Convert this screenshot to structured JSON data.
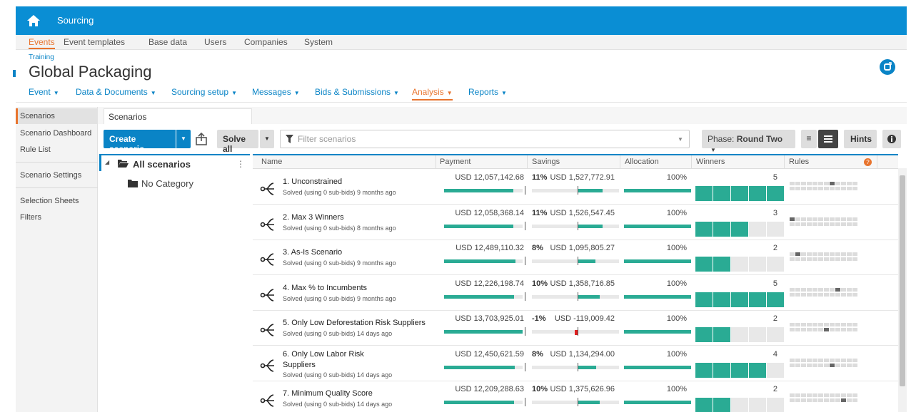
{
  "app": {
    "title": "Sourcing"
  },
  "topnav": [
    "Events",
    "Event templates",
    "Base data",
    "Users",
    "Companies",
    "System"
  ],
  "breadcrumb": "Training",
  "page_title": "Global Packaging",
  "menu": [
    {
      "label": "Event"
    },
    {
      "label": "Data & Documents"
    },
    {
      "label": "Sourcing setup"
    },
    {
      "label": "Messages"
    },
    {
      "label": "Bids & Submissions"
    },
    {
      "label": "Analysis"
    },
    {
      "label": "Reports"
    }
  ],
  "sidebar": [
    "Scenarios",
    "Scenario Dashboard",
    "Rule List",
    "Scenario Settings",
    "Selection Sheets",
    "Filters"
  ],
  "tab_label": "Scenarios",
  "toolbar": {
    "create": "Create scenario",
    "solve_all": "Solve all",
    "filter_placeholder": "Filter scenarios",
    "phase_prefix": "Phase:",
    "phase_value": "Round Two",
    "hints": "Hints"
  },
  "tree": {
    "root": "All scenarios",
    "child": "No Category"
  },
  "columns": [
    "Name",
    "Payment",
    "Savings",
    "Allocation",
    "Winners",
    "Rules"
  ],
  "colors": {
    "accent": "#0a84c6",
    "active_orange": "#e8742e",
    "bar_green": "#2aab94",
    "negative": "#e02020"
  },
  "rows": [
    {
      "name": "1. Unconstrained",
      "name2": "",
      "status": "Solved (using 0 sub-bids) 9 months ago",
      "payment": "USD 12,057,142.68",
      "pct": "11%",
      "savings": "USD 1,527,772.91",
      "allocation": "100%",
      "winners": "5",
      "pay_fill": 0.88,
      "sav_fill": 0.6,
      "win_fill": 5,
      "rule_on": [
        7
      ]
    },
    {
      "name": "2. Max 3 Winners",
      "name2": "",
      "status": "Solved (using 0 sub-bids) 8 months ago",
      "payment": "USD 12,058,368.14",
      "pct": "11%",
      "savings": "USD 1,526,547.45",
      "allocation": "100%",
      "winners": "3",
      "pay_fill": 0.88,
      "sav_fill": 0.6,
      "win_fill": 3,
      "rule_on": [
        0
      ]
    },
    {
      "name": "3. As-Is Scenario",
      "name2": "",
      "status": "Solved (using 0 sub-bids) 9 months ago",
      "payment": "USD 12,489,110.32",
      "pct": "8%",
      "savings": "USD 1,095,805.27",
      "allocation": "100%",
      "winners": "2",
      "pay_fill": 0.91,
      "sav_fill": 0.43,
      "win_fill": 2,
      "rule_on": [
        1
      ]
    },
    {
      "name": "4. Max % to Incumbents",
      "name2": "",
      "status": "Solved (using 0 sub-bids) 9 months ago",
      "payment": "USD 12,226,198.74",
      "pct": "10%",
      "savings": "USD 1,358,716.85",
      "allocation": "100%",
      "winners": "5",
      "pay_fill": 0.89,
      "sav_fill": 0.53,
      "win_fill": 5,
      "rule_on": [
        8
      ]
    },
    {
      "name": "5. Only Low Deforestation Risk Suppliers",
      "name2": "",
      "status": "Solved (using 0 sub-bids) 14 days ago",
      "payment": "USD 13,703,925.01",
      "pct": "-1%",
      "savings": "USD -119,009.42",
      "allocation": "100%",
      "winners": "2",
      "pay_fill": 1.0,
      "sav_fill": 0.0,
      "win_fill": 2,
      "rule_on": [
        18
      ]
    },
    {
      "name": "6. Only Low Labor Risk",
      "name2": "Suppliers",
      "status": "Solved (using 0 sub-bids) 14 days ago",
      "payment": "USD 12,450,621.59",
      "pct": "8%",
      "savings": "USD 1,134,294.00",
      "allocation": "100%",
      "winners": "4",
      "pay_fill": 0.9,
      "sav_fill": 0.45,
      "win_fill": 4,
      "rule_on": [
        19
      ]
    },
    {
      "name": "7. Minimum Quality Score",
      "name2": "",
      "status": "Solved (using 0 sub-bids) 14 days ago",
      "payment": "USD 12,209,288.63",
      "pct": "10%",
      "savings": "USD 1,375,626.96",
      "allocation": "100%",
      "winners": "2",
      "pay_fill": 0.89,
      "sav_fill": 0.54,
      "win_fill": 2,
      "rule_on": [
        21
      ]
    }
  ]
}
